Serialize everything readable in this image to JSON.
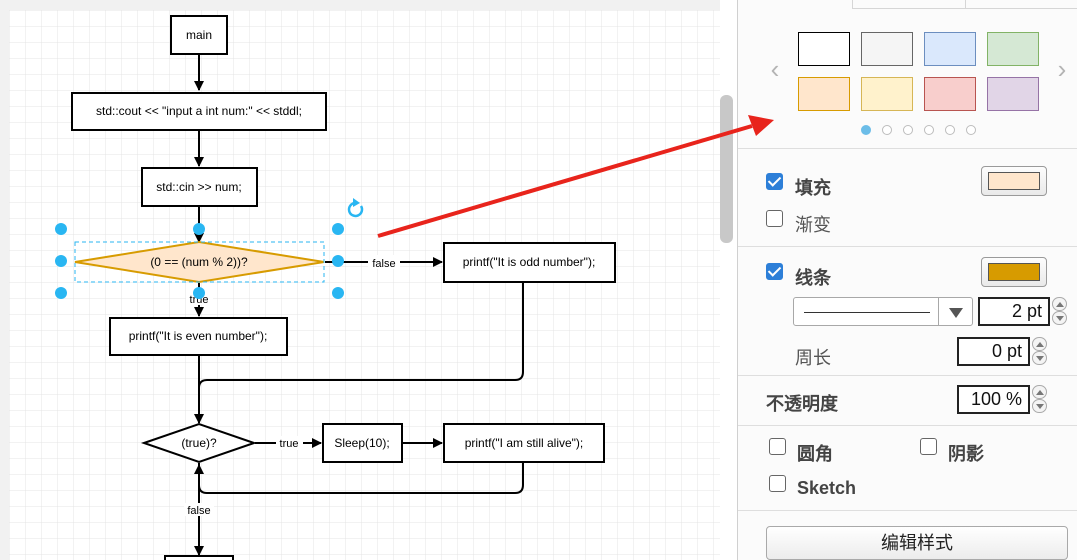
{
  "diagram": {
    "nodes": {
      "main": "main",
      "cout": "std::cout << \"input a int num:\" << stddl;",
      "cin": "std::cin >> num;",
      "cond": "(0 == (num % 2))?",
      "odd": "printf(\"It is odd number\");",
      "even": "printf(\"It is even number\");",
      "loop": "(true)?",
      "sleep": "Sleep(10);",
      "alive": "printf(\"I am still alive\");"
    },
    "edge_labels": {
      "cond_false": "false",
      "cond_true": "true",
      "loop_true": "true",
      "loop_false": "false"
    },
    "selected_node": "cond"
  },
  "format_panel": {
    "swatches": [
      {
        "name": "white",
        "fill": "#ffffff",
        "stroke": "#000000"
      },
      {
        "name": "light-gray",
        "fill": "#f5f5f5",
        "stroke": "#666666"
      },
      {
        "name": "light-blue",
        "fill": "#dae8fc",
        "stroke": "#6c8ebf"
      },
      {
        "name": "light-green",
        "fill": "#d5e8d4",
        "stroke": "#82b366"
      },
      {
        "name": "light-orange",
        "fill": "#ffe6cc",
        "stroke": "#d79b00"
      },
      {
        "name": "light-yellow",
        "fill": "#fff2cc",
        "stroke": "#d6b656"
      },
      {
        "name": "light-red",
        "fill": "#f8cecc",
        "stroke": "#b85450"
      },
      {
        "name": "light-purple",
        "fill": "#e1d5e7",
        "stroke": "#9673a6"
      }
    ],
    "swatch_page": 1,
    "swatch_page_count": 6,
    "fill": {
      "label": "填充",
      "checked": true,
      "color": "#ffe6cc"
    },
    "gradient": {
      "label": "渐变",
      "checked": false
    },
    "line": {
      "label": "线条",
      "checked": true,
      "color": "#d79b00",
      "width": "2 pt"
    },
    "perimeter": {
      "label": "周长",
      "value": "0 pt"
    },
    "opacity": {
      "label": "不透明度",
      "value": "100 %"
    },
    "rounded": {
      "label": "圆角",
      "checked": false
    },
    "shadow": {
      "label": "阴影",
      "checked": false
    },
    "sketch": {
      "label": "Sketch",
      "checked": false
    },
    "edit_style_label": "编辑样式"
  },
  "colors": {
    "selection": "#29b6f2",
    "annotation_arrow": "#e8241c",
    "decision_fill": "#ffe6cc",
    "decision_stroke": "#d79b00"
  }
}
